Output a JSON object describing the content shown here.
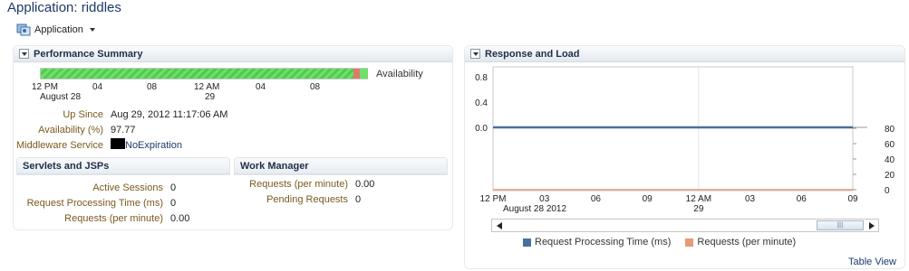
{
  "page": {
    "title": "Application: riddles"
  },
  "menu": {
    "label": "Application"
  },
  "perf": {
    "title": "Performance Summary",
    "availability_label": "Availability",
    "bar_fill_fraction": 0.95,
    "time_ticks": [
      "12 PM",
      "04",
      "08",
      "12 AM",
      "04",
      "08"
    ],
    "date_under_12pm": "August 28",
    "date_under_12am": "29",
    "fields": [
      {
        "label": "Up Since",
        "value": "Aug 29, 2012 11:17:06 AM"
      },
      {
        "label": "Availability (%)",
        "value": "97.77"
      },
      {
        "label": "Middleware Service",
        "value": "NoExpiration"
      }
    ],
    "servlets": {
      "title": "Servlets and JSPs",
      "rows": [
        {
          "label": "Active Sessions",
          "value": "0"
        },
        {
          "label": "Request Processing Time (ms)",
          "value": "0"
        },
        {
          "label": "Requests (per minute)",
          "value": "0.00"
        }
      ]
    },
    "work_manager": {
      "title": "Work Manager",
      "rows": [
        {
          "label": "Requests (per minute)",
          "value": "0.00"
        },
        {
          "label": "Pending Requests",
          "value": "0"
        }
      ]
    }
  },
  "response": {
    "title": "Response and Load",
    "table_view": "Table View"
  },
  "colors": {
    "series1": "#4a6f9c",
    "series2": "#e89a76",
    "green": "#5fd75a"
  },
  "chart_data": {
    "type": "line",
    "x": [
      "12 PM",
      "03",
      "06",
      "09",
      "12 AM",
      "03",
      "06",
      "09"
    ],
    "x_sub": {
      "12 PM": "August 28 2012",
      "12 AM": "29"
    },
    "y_left_ticks": [
      "0.8",
      "0.4",
      "0.0"
    ],
    "y_right_ticks": [
      "80",
      "60",
      "40",
      "20",
      "0"
    ],
    "ylim_left": [
      0,
      0.8
    ],
    "ylim_right": [
      0,
      80
    ],
    "series": [
      {
        "name": "Request Processing Time (ms)",
        "values": [
          0,
          0,
          0,
          0,
          0,
          0,
          0,
          0
        ],
        "axis": "left"
      },
      {
        "name": "Requests (per minute)",
        "values": [
          0,
          0,
          0,
          0,
          0,
          0,
          0,
          0
        ],
        "axis": "right"
      }
    ]
  }
}
